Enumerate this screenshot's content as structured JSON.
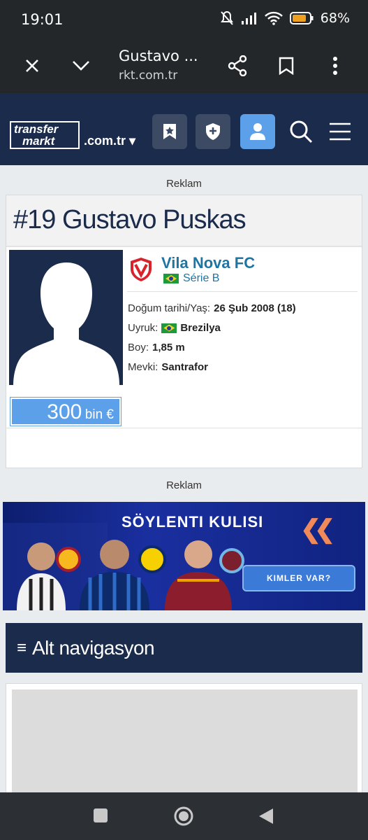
{
  "status_bar": {
    "time": "19:01",
    "battery": "68%"
  },
  "browser": {
    "title": "Gustavo ...",
    "url_faded": "",
    "url": "rkt.com.tr"
  },
  "site": {
    "logo_line1": "transfer",
    "logo_line2": "markt",
    "domain": ".com.tr ▾"
  },
  "ads": {
    "label_top": "Reklam",
    "label_mid": "Reklam"
  },
  "player": {
    "title": "#19 Gustavo Puskas",
    "club": "Vila Nova FC",
    "league": "Série B",
    "market_value_number": "300",
    "market_value_unit": "bin €",
    "birth_label": "Doğum tarihi/Yaş:",
    "birth_value": "26 Şub 2008 (18)",
    "nationality_label": "Uyruk:",
    "nationality_value": "Brezilya",
    "height_label": "Boy:",
    "height_value": "1,85 m",
    "position_label": "Mevki:",
    "position_value": "Santrafor"
  },
  "banner": {
    "title": "SÖYLENTI KULISI",
    "button": "KIMLER VAR?"
  },
  "alt_nav": {
    "label": "Alt navigasyon",
    "icon": "≡"
  },
  "colors": {
    "navy": "#1a2b4c",
    "accent_blue": "#5ba0e8",
    "link_blue": "#1d75a3"
  }
}
